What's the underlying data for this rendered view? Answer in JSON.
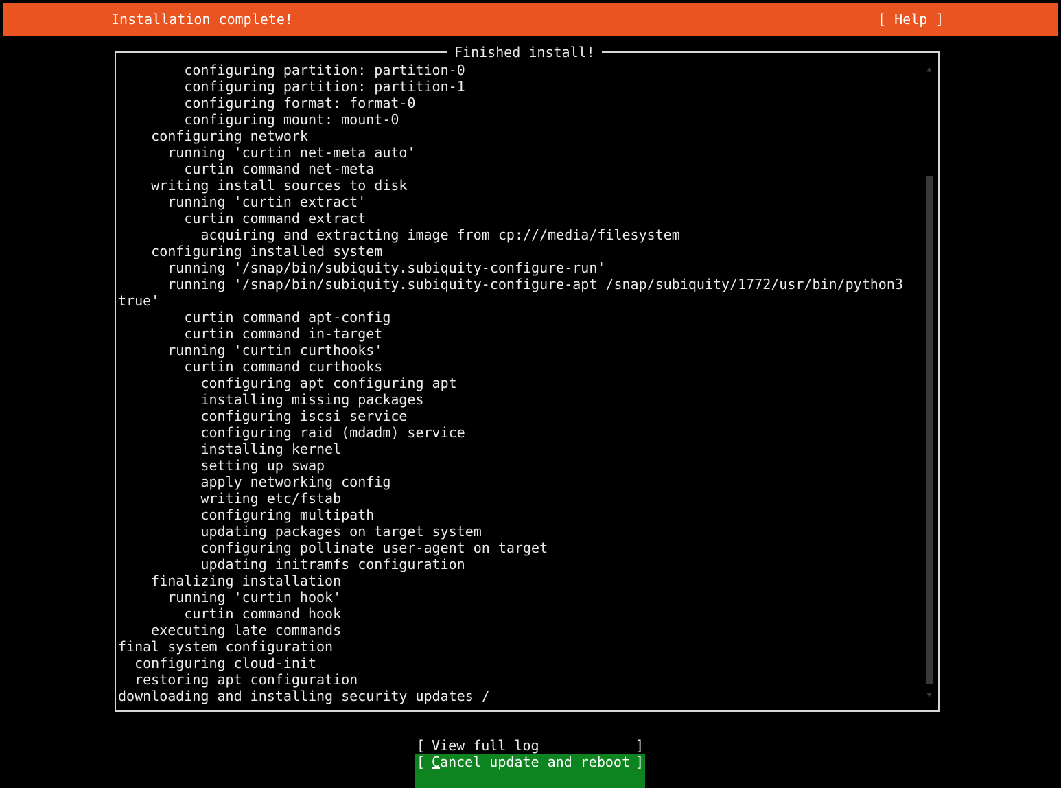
{
  "header": {
    "title": "Installation complete!",
    "help_label": "[ Help ]",
    "bg_color": "#e95420"
  },
  "panel": {
    "title": "Finished install!"
  },
  "log_lines": [
    "        configuring partition: partition-0",
    "        configuring partition: partition-1",
    "        configuring format: format-0",
    "        configuring mount: mount-0",
    "    configuring network",
    "      running 'curtin net-meta auto'",
    "        curtin command net-meta",
    "    writing install sources to disk",
    "      running 'curtin extract'",
    "        curtin command extract",
    "          acquiring and extracting image from cp:///media/filesystem",
    "    configuring installed system",
    "      running '/snap/bin/subiquity.subiquity-configure-run'",
    "      running '/snap/bin/subiquity.subiquity-configure-apt /snap/subiquity/1772/usr/bin/python3",
    "true'",
    "        curtin command apt-config",
    "        curtin command in-target",
    "      running 'curtin curthooks'",
    "        curtin command curthooks",
    "          configuring apt configuring apt",
    "          installing missing packages",
    "          configuring iscsi service",
    "          configuring raid (mdadm) service",
    "          installing kernel",
    "          setting up swap",
    "          apply networking config",
    "          writing etc/fstab",
    "          configuring multipath",
    "          updating packages on target system",
    "          configuring pollinate user-agent on target",
    "          updating initramfs configuration",
    "    finalizing installation",
    "      running 'curtin hook'",
    "        curtin command hook",
    "    executing late commands",
    "final system configuration",
    "  configuring cloud-init",
    "  restoring apt configuration",
    "downloading and installing security updates /"
  ],
  "scrollbar": {
    "up_glyph": "▲",
    "down_glyph": "▼"
  },
  "buttons": {
    "left_bracket": "[",
    "right_bracket": "]",
    "view_log": "View full log",
    "cancel_hotkey": "C",
    "cancel_rest": "ancel update and reboot",
    "cancel_bg": "#0e8420"
  }
}
